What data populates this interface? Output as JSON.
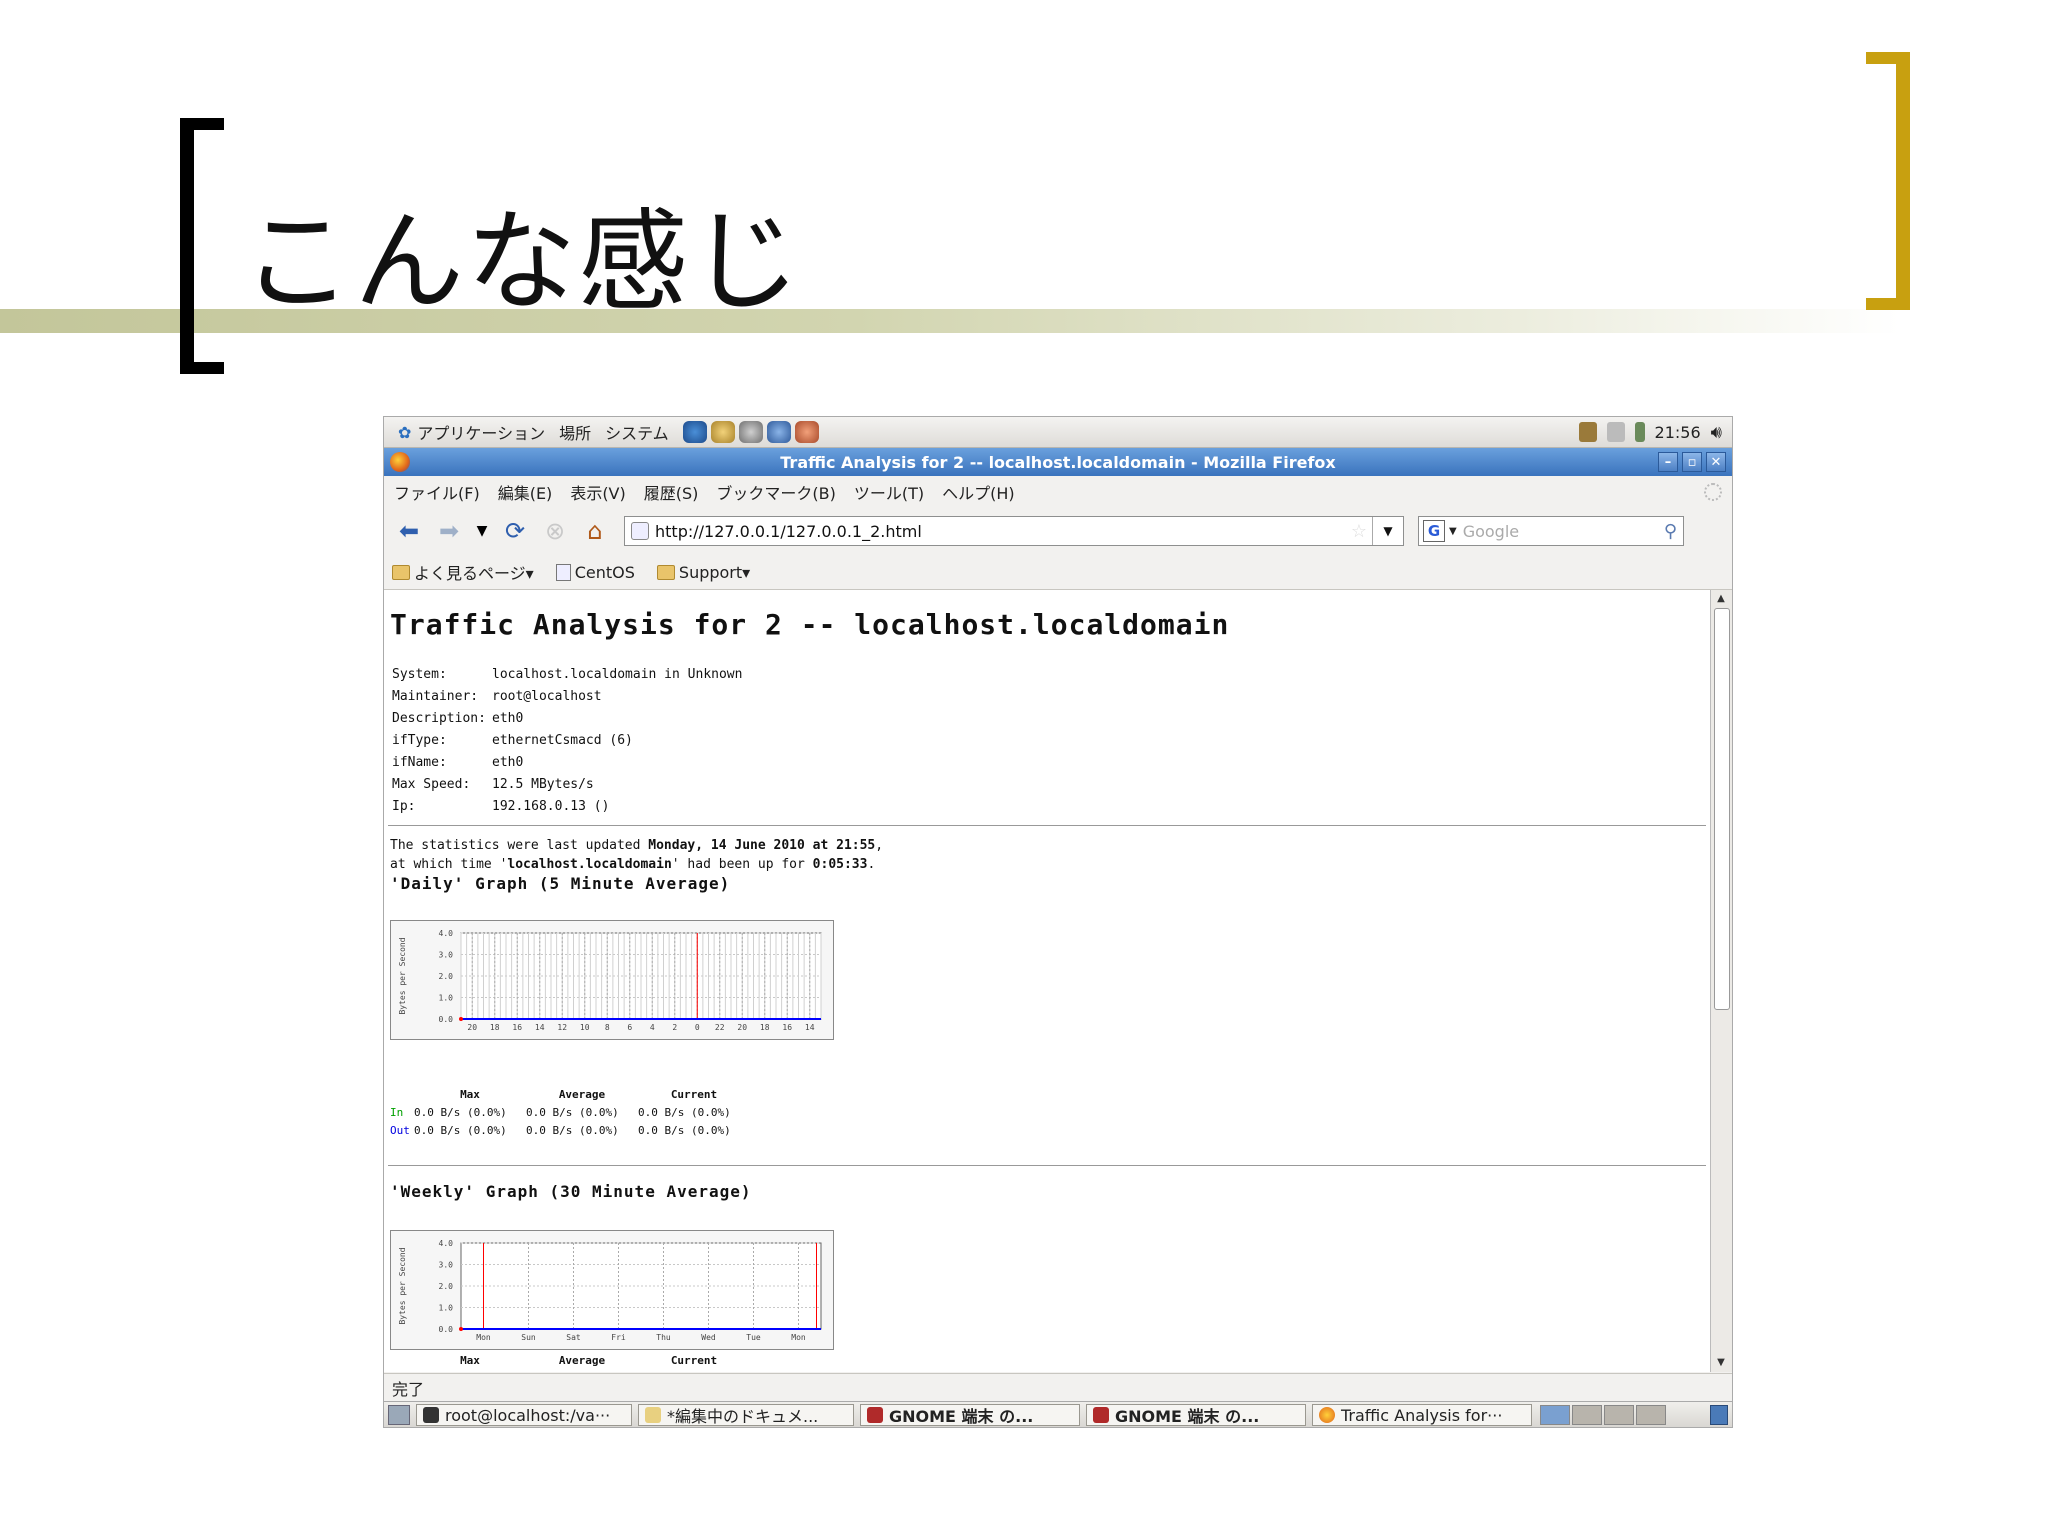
{
  "slide": {
    "title": "こんな感じ"
  },
  "gnome_panel": {
    "menus": [
      "アプリケーション",
      "場所",
      "システム"
    ],
    "clock": "21:56"
  },
  "window": {
    "title": "Traffic Analysis for 2 -- localhost.localdomain - Mozilla Firefox"
  },
  "menubar": [
    "ファイル(F)",
    "編集(E)",
    "表示(V)",
    "履歴(S)",
    "ブックマーク(B)",
    "ツール(T)",
    "ヘルプ(H)"
  ],
  "navbar": {
    "url": "http://127.0.0.1/127.0.0.1_2.html",
    "search_placeholder": "Google",
    "search_engine_letter": "G"
  },
  "bookmarks": [
    "よく見るページ▾",
    "CentOS",
    "Support▾"
  ],
  "page": {
    "heading": "Traffic Analysis for 2 -- localhost.localdomain",
    "info": [
      {
        "k": "System:",
        "v": "localhost.localdomain in Unknown"
      },
      {
        "k": "Maintainer:",
        "v": "root@localhost"
      },
      {
        "k": "Description:",
        "v": "eth0"
      },
      {
        "k": "ifType:",
        "v": "ethernetCsmacd (6)"
      },
      {
        "k": "ifName:",
        "v": "eth0"
      },
      {
        "k": "Max Speed:",
        "v": "12.5 MBytes/s"
      },
      {
        "k": "Ip:",
        "v": "192.168.0.13 ()"
      }
    ],
    "stat_line1_pre": "The statistics were last updated ",
    "stat_line1_bold": "Monday, 14 June 2010 at 21:55",
    "stat_line1_post": ",",
    "stat_line2_pre": "at which time '",
    "stat_line2_bold": "localhost.localdomain",
    "stat_line2_mid": "' had been up for ",
    "stat_line2_bold2": "0:05:33",
    "stat_line2_post": ".",
    "daily_title": "'Daily' Graph (5 Minute Average)",
    "weekly_title": "'Weekly' Graph (30 Minute Average)",
    "table_headers": [
      "Max",
      "Average",
      "Current"
    ],
    "rows": [
      {
        "label": "In",
        "max": "0.0 B/s (0.0%)",
        "avg": "0.0 B/s (0.0%)",
        "cur": "0.0 B/s (0.0%)"
      },
      {
        "label": "Out",
        "max": "0.0 B/s (0.0%)",
        "avg": "0.0 B/s (0.0%)",
        "cur": "0.0 B/s (0.0%)"
      }
    ]
  },
  "chart_data": [
    {
      "type": "area",
      "title": "'Daily' Graph (5 Minute Average)",
      "ylabel": "Bytes per Second",
      "y_ticks": [
        "0.0",
        "1.0",
        "2.0",
        "3.0",
        "4.0"
      ],
      "ylim": [
        0,
        4
      ],
      "x_ticks": [
        "20",
        "18",
        "16",
        "14",
        "12",
        "10",
        "8",
        "6",
        "4",
        "2",
        "0",
        "22",
        "20",
        "18",
        "16",
        "14"
      ],
      "series": [
        {
          "name": "In",
          "values": [
            0
          ]
        },
        {
          "name": "Out",
          "values": [
            0
          ]
        }
      ],
      "grid": true,
      "colors": {
        "in": "#00cc00",
        "out": "#0000ff",
        "marker": "#ff0000"
      }
    },
    {
      "type": "area",
      "title": "'Weekly' Graph (30 Minute Average)",
      "ylabel": "Bytes per Second",
      "y_ticks": [
        "0.0",
        "1.0",
        "2.0",
        "3.0",
        "4.0"
      ],
      "ylim": [
        0,
        4
      ],
      "x_ticks": [
        "Mon",
        "Sun",
        "Sat",
        "Fri",
        "Thu",
        "Wed",
        "Tue",
        "Mon"
      ],
      "series": [
        {
          "name": "In",
          "values": [
            0
          ]
        },
        {
          "name": "Out",
          "values": [
            0
          ]
        }
      ],
      "grid": true,
      "colors": {
        "in": "#00cc00",
        "out": "#0000ff",
        "marker": "#ff0000"
      }
    }
  ],
  "statusbar": {
    "text": "完了"
  },
  "taskbar": [
    "root@localhost:/va···",
    "*編集中のドキュメ...",
    "GNOME 端末 の...",
    "GNOME 端末 の...",
    "Traffic Analysis for···"
  ]
}
